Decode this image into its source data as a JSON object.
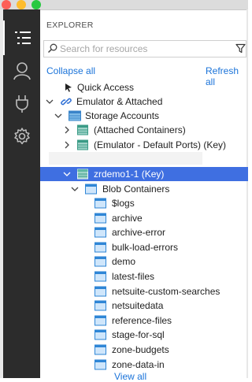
{
  "explorer": {
    "title": "EXPLORER",
    "search_placeholder": "Search for resources",
    "collapse_all": "Collapse all",
    "refresh_all": "Refresh all"
  },
  "tree": {
    "quick_access": "Quick Access",
    "emulator_attached": "Emulator & Attached",
    "storage_accounts": "Storage Accounts",
    "attached_containers": "(Attached Containers)",
    "emulator_default": "(Emulator - Default Ports) (Key)",
    "selected_account": "zrdemo1-1 (Key)",
    "blob_containers": "Blob Containers",
    "containers": [
      "$logs",
      "archive",
      "archive-error",
      "bulk-load-errors",
      "demo",
      "latest-files",
      "netsuite-custom-searches",
      "netsuitedata",
      "reference-files",
      "stage-for-sql",
      "zone-budgets",
      "zone-data-in"
    ],
    "view_all": "View all"
  },
  "colors": {
    "activity_bar": "#2c2c2c",
    "selection": "#3f6fe1",
    "link": "#1a73d9",
    "close": "#fd5f57",
    "minimize": "#febc2e",
    "maximize": "#28c840"
  }
}
